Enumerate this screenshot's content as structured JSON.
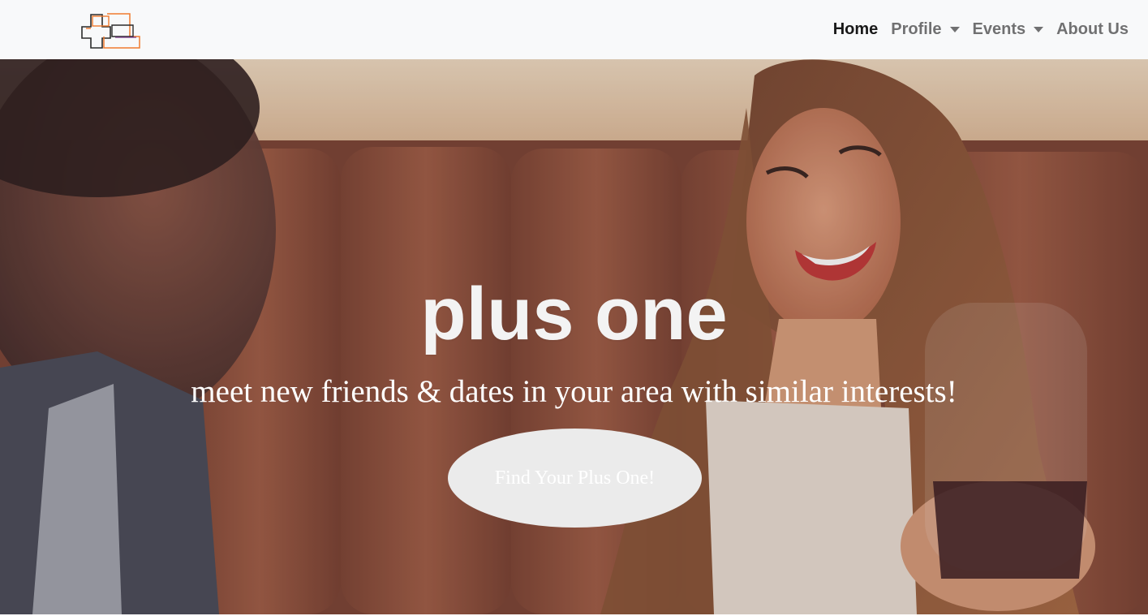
{
  "navbar": {
    "brand_icon": "plus-one-logo-icon",
    "items": [
      {
        "label": "Home",
        "active": true,
        "dropdown": false
      },
      {
        "label": "Profile",
        "active": false,
        "dropdown": true
      },
      {
        "label": "Events",
        "active": false,
        "dropdown": true
      },
      {
        "label": "About Us",
        "active": false,
        "dropdown": false
      }
    ]
  },
  "hero": {
    "title": "plus one",
    "subtitle": "meet new friends & dates in your area with similar interests!",
    "cta_label": "Find Your Plus One!",
    "background_image": "couple-at-restaurant-photo"
  },
  "colors": {
    "navbar_bg": "#f8f9fa",
    "logo_orange": "#f07a2e",
    "logo_dark": "#2a2a2a",
    "title_text": "#f3f3f3",
    "cta_bg": "#ebebeb"
  }
}
